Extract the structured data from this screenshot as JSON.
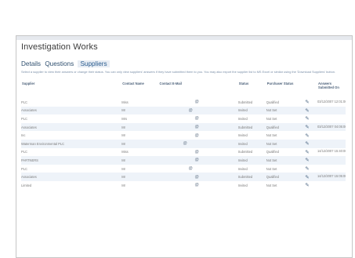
{
  "app": {
    "title": "Investigation Works"
  },
  "tabs": [
    {
      "label": "Details"
    },
    {
      "label": "Questions"
    },
    {
      "label": "Suppliers"
    }
  ],
  "intro": "Select a supplier to view their answers or change their status. You can only view suppliers' answers if they have submitted them to you. You may also export the supplier list to MS Excel or similar using the 'Download Suppliers' button.",
  "table": {
    "headers": [
      "Supplier",
      "Contact Name",
      "Contact E-Mail",
      "Status",
      "Purchaser Status",
      "Answers Submitted On"
    ],
    "rows": [
      {
        "supplier": "PLC",
        "contact": "Miss",
        "email": "@",
        "status": "Submitted",
        "pstatus": "Qualified",
        "answers": "03/12/2007 12:01:00"
      },
      {
        "supplier": "Associates",
        "contact": "Mr",
        "email": "@",
        "status": "Invited",
        "pstatus": "Not Set",
        "answers": ""
      },
      {
        "supplier": "PLC",
        "contact": "Mrs",
        "email": "@",
        "status": "Invited",
        "pstatus": "Not Set",
        "answers": ""
      },
      {
        "supplier": "Associates",
        "contact": "Mr",
        "email": "@",
        "status": "Submitted",
        "pstatus": "Qualified",
        "answers": "03/12/2007 04:05:00"
      },
      {
        "supplier": "Inc",
        "contact": "Mr",
        "email": "@",
        "status": "Invited",
        "pstatus": "Not Set",
        "answers": ""
      },
      {
        "supplier": "Waterman Environmental PLC",
        "contact": "Mr",
        "email": "@",
        "status": "Invited",
        "pstatus": "Not Set",
        "answers": ""
      },
      {
        "supplier": "PLC",
        "contact": "Miss",
        "email": "@",
        "status": "Submitted",
        "pstatus": "Qualified",
        "answers": "14/12/2007 15:40:00"
      },
      {
        "supplier": "PARTNERS",
        "contact": "Mr",
        "email": "@",
        "status": "Invited",
        "pstatus": "Not Set",
        "answers": ""
      },
      {
        "supplier": "PLC",
        "contact": "Mr",
        "email": "@",
        "status": "Invited",
        "pstatus": "Not Set",
        "answers": ""
      },
      {
        "supplier": "Associates",
        "contact": "Mr",
        "email": "@",
        "status": "Submitted",
        "pstatus": "Qualified",
        "answers": "14/12/2007 15:05:00"
      },
      {
        "supplier": "Limited",
        "contact": "Mr",
        "email": "@",
        "status": "Invited",
        "pstatus": "Not Set",
        "answers": ""
      }
    ]
  },
  "icons": {
    "mail": "mail-icon",
    "edit": "edit-icon"
  },
  "colors": {
    "link": "#2b5d8f",
    "row_alt": "#eef3f9",
    "border": "#c6c6c6"
  }
}
